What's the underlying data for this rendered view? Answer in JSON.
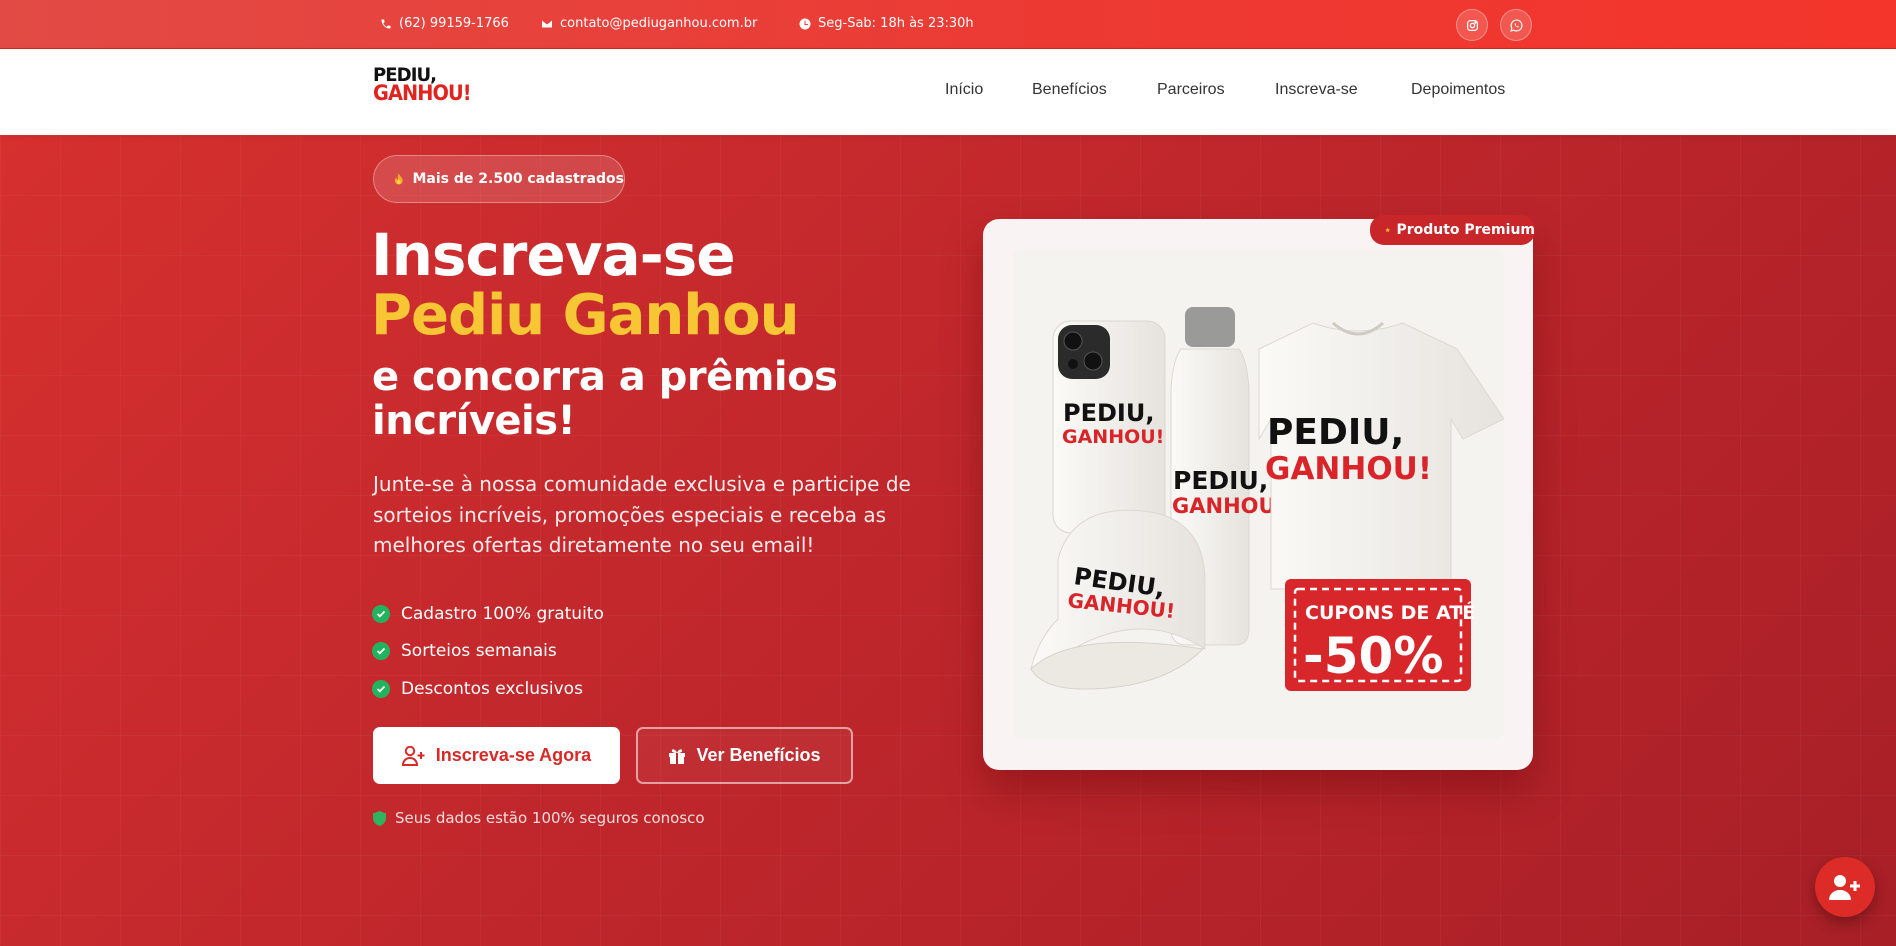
{
  "topbar": {
    "phone": "(62) 99159-1766",
    "email": "contato@pediuganhou.com.br",
    "hours": "Seg-Sab: 18h às 23:30h",
    "social": [
      "instagram-icon",
      "whatsapp-icon"
    ]
  },
  "header": {
    "logo_line1": "PEDIU,",
    "logo_line2": "GANHOU!",
    "nav": [
      "Início",
      "Benefícios",
      "Parceiros",
      "Inscreva-se",
      "Depoimentos"
    ]
  },
  "hero": {
    "badge": "Mais de 2.500 cadastrados",
    "title_line1": "Inscreva-se",
    "title_line2": "Pediu Ganhou",
    "title_line3": "e concorra a prêmios incríveis!",
    "lead": "Junte-se à nossa comunidade exclusiva e participe de sorteios incríveis, promoções especiais e receba as melhores ofertas diretamente no seu email!",
    "checks": [
      "Cadastro 100% gratuito",
      "Sorteios semanais",
      "Descontos exclusivos"
    ],
    "primary_button": "Inscreva-se Agora",
    "secondary_button": "Ver Benefícios",
    "secure_note": "Seus dados estão 100% seguros conosco"
  },
  "product_card": {
    "badge": "Produto Premium",
    "brand_line1": "PEDIU,",
    "brand_line2": "GANHOU!",
    "coupon_line1": "CUPONS DE ATÉ",
    "coupon_line2": "-50%"
  },
  "colors": {
    "brand_red": "#e0241f",
    "accent_yellow": "#f7c634",
    "check_green": "#22b35e"
  }
}
